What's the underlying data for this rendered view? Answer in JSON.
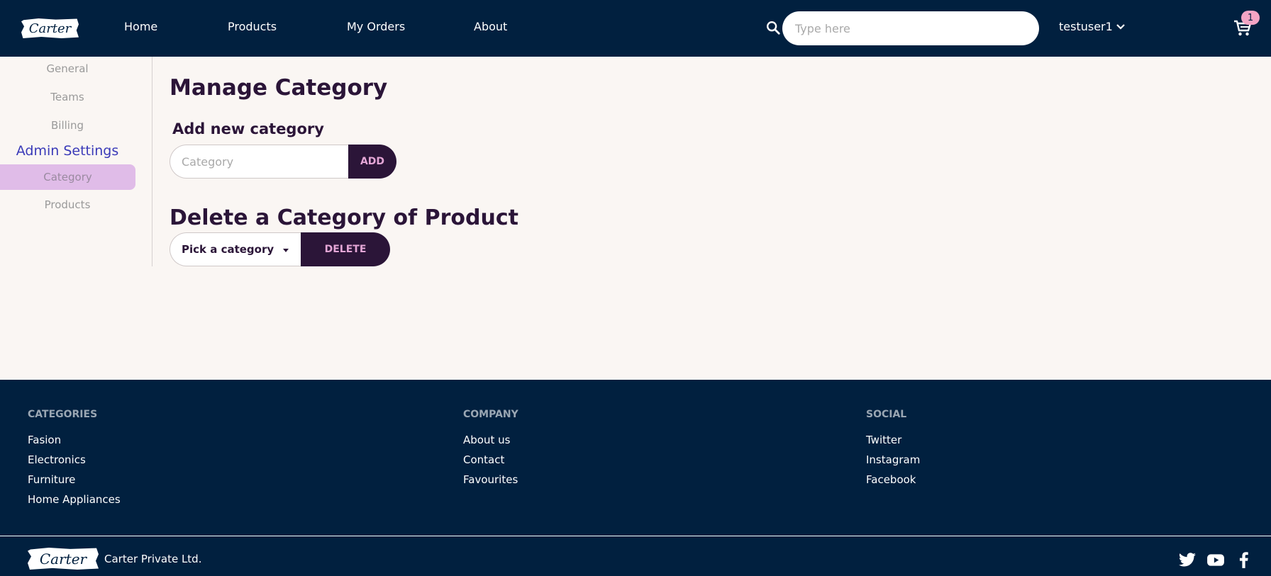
{
  "nav": {
    "logo_text": "Carter",
    "links": [
      "Home",
      "Products",
      "My Orders",
      "About"
    ],
    "search_placeholder": "Type here",
    "user": "testuser1",
    "cart_count": "1"
  },
  "sidebar": {
    "items": [
      "General",
      "Teams",
      "Billing"
    ],
    "admin_heading": "Admin Settings",
    "admin_items": [
      "Category",
      "Products"
    ]
  },
  "main": {
    "title": "Manage Category",
    "add_heading": "Add new category",
    "category_placeholder": "Category",
    "add_label": "ADD",
    "delete_heading": "Delete a Category of Product",
    "select_label": "Pick a category",
    "delete_label": "DELETE"
  },
  "footer": {
    "columns": [
      {
        "heading": "CATEGORIES",
        "links": [
          "Fasion",
          "Electronics",
          "Furniture",
          "Home Appliances"
        ]
      },
      {
        "heading": "COMPANY",
        "links": [
          "About us",
          "Contact",
          "Favourites"
        ]
      },
      {
        "heading": "SOCIAL",
        "links": [
          "Twitter",
          "Instagram",
          "Facebook"
        ]
      }
    ],
    "logo_text": "Carter",
    "company": "Carter Private Ltd."
  },
  "colors": {
    "navbar": "#01203f",
    "page_bg": "#faf6f3",
    "accent_dark": "#2b1538",
    "button_text": "#e4a6d6",
    "active_item": "#e0bce8",
    "admin_heading": "#3a3ab8",
    "badge": "#f4a4c4"
  },
  "icons": [
    "search-icon",
    "chevron-down-icon",
    "cart-icon",
    "twitter-icon",
    "youtube-icon",
    "facebook-icon"
  ]
}
